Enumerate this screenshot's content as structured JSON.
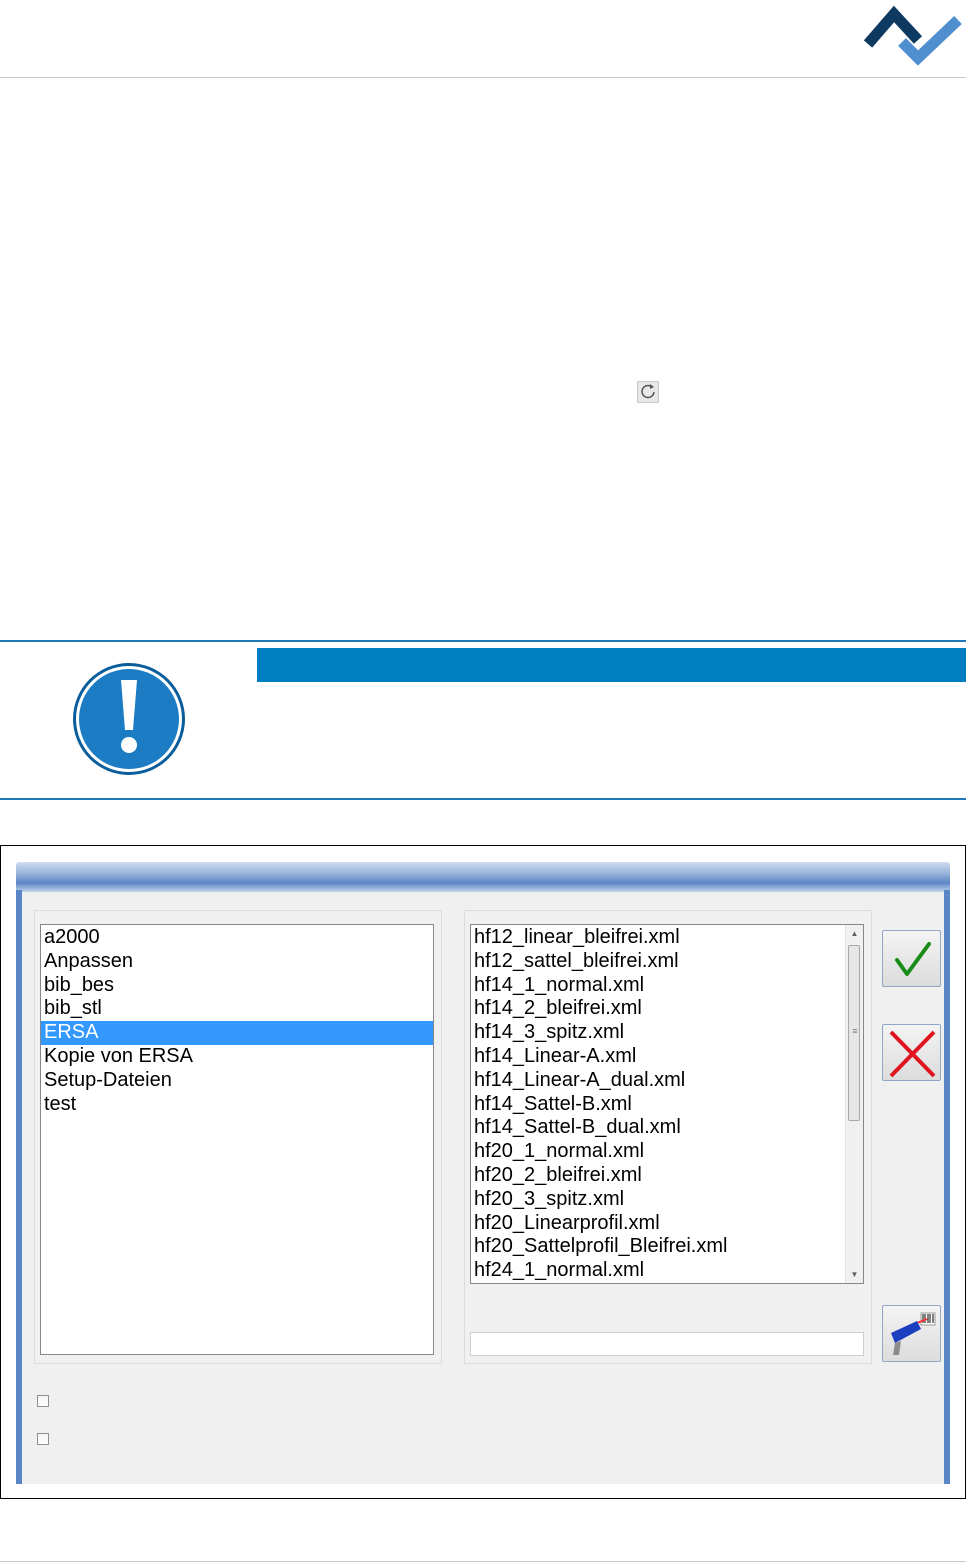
{
  "header": {
    "logo_icon": "ersa-logo-icon"
  },
  "toolbar": {
    "refresh_icon": "refresh-icon"
  },
  "note": {
    "icon": "exclamation-icon",
    "accent_color": "#007ec2"
  },
  "dialog": {
    "folders": [
      "a2000",
      "Anpassen",
      "bib_bes",
      "bib_stl",
      "ERSA",
      "Kopie von ERSA",
      "Setup-Dateien",
      "test"
    ],
    "selected_folder": "ERSA",
    "files": [
      "hf12_linear_bleifrei.xml",
      "hf12_sattel_bleifrei.xml",
      "hf14_1_normal.xml",
      "hf14_2_bleifrei.xml",
      "hf14_3_spitz.xml",
      "hf14_Linear-A.xml",
      "hf14_Linear-A_dual.xml",
      "hf14_Sattel-B.xml",
      "hf14_Sattel-B_dual.xml",
      "hf20_1_normal.xml",
      "hf20_2_bleifrei.xml",
      "hf20_3_spitz.xml",
      "hf20_Linearprofil.xml",
      "hf20_Sattelprofil_Bleifrei.xml",
      "hf24_1_normal.xml"
    ],
    "filename_value": "",
    "buttons": {
      "ok_icon": "checkmark-icon",
      "cancel_icon": "cross-icon",
      "scan_icon": "barcode-scanner-icon"
    },
    "checkboxes": [
      {
        "checked": false
      },
      {
        "checked": false
      }
    ]
  }
}
